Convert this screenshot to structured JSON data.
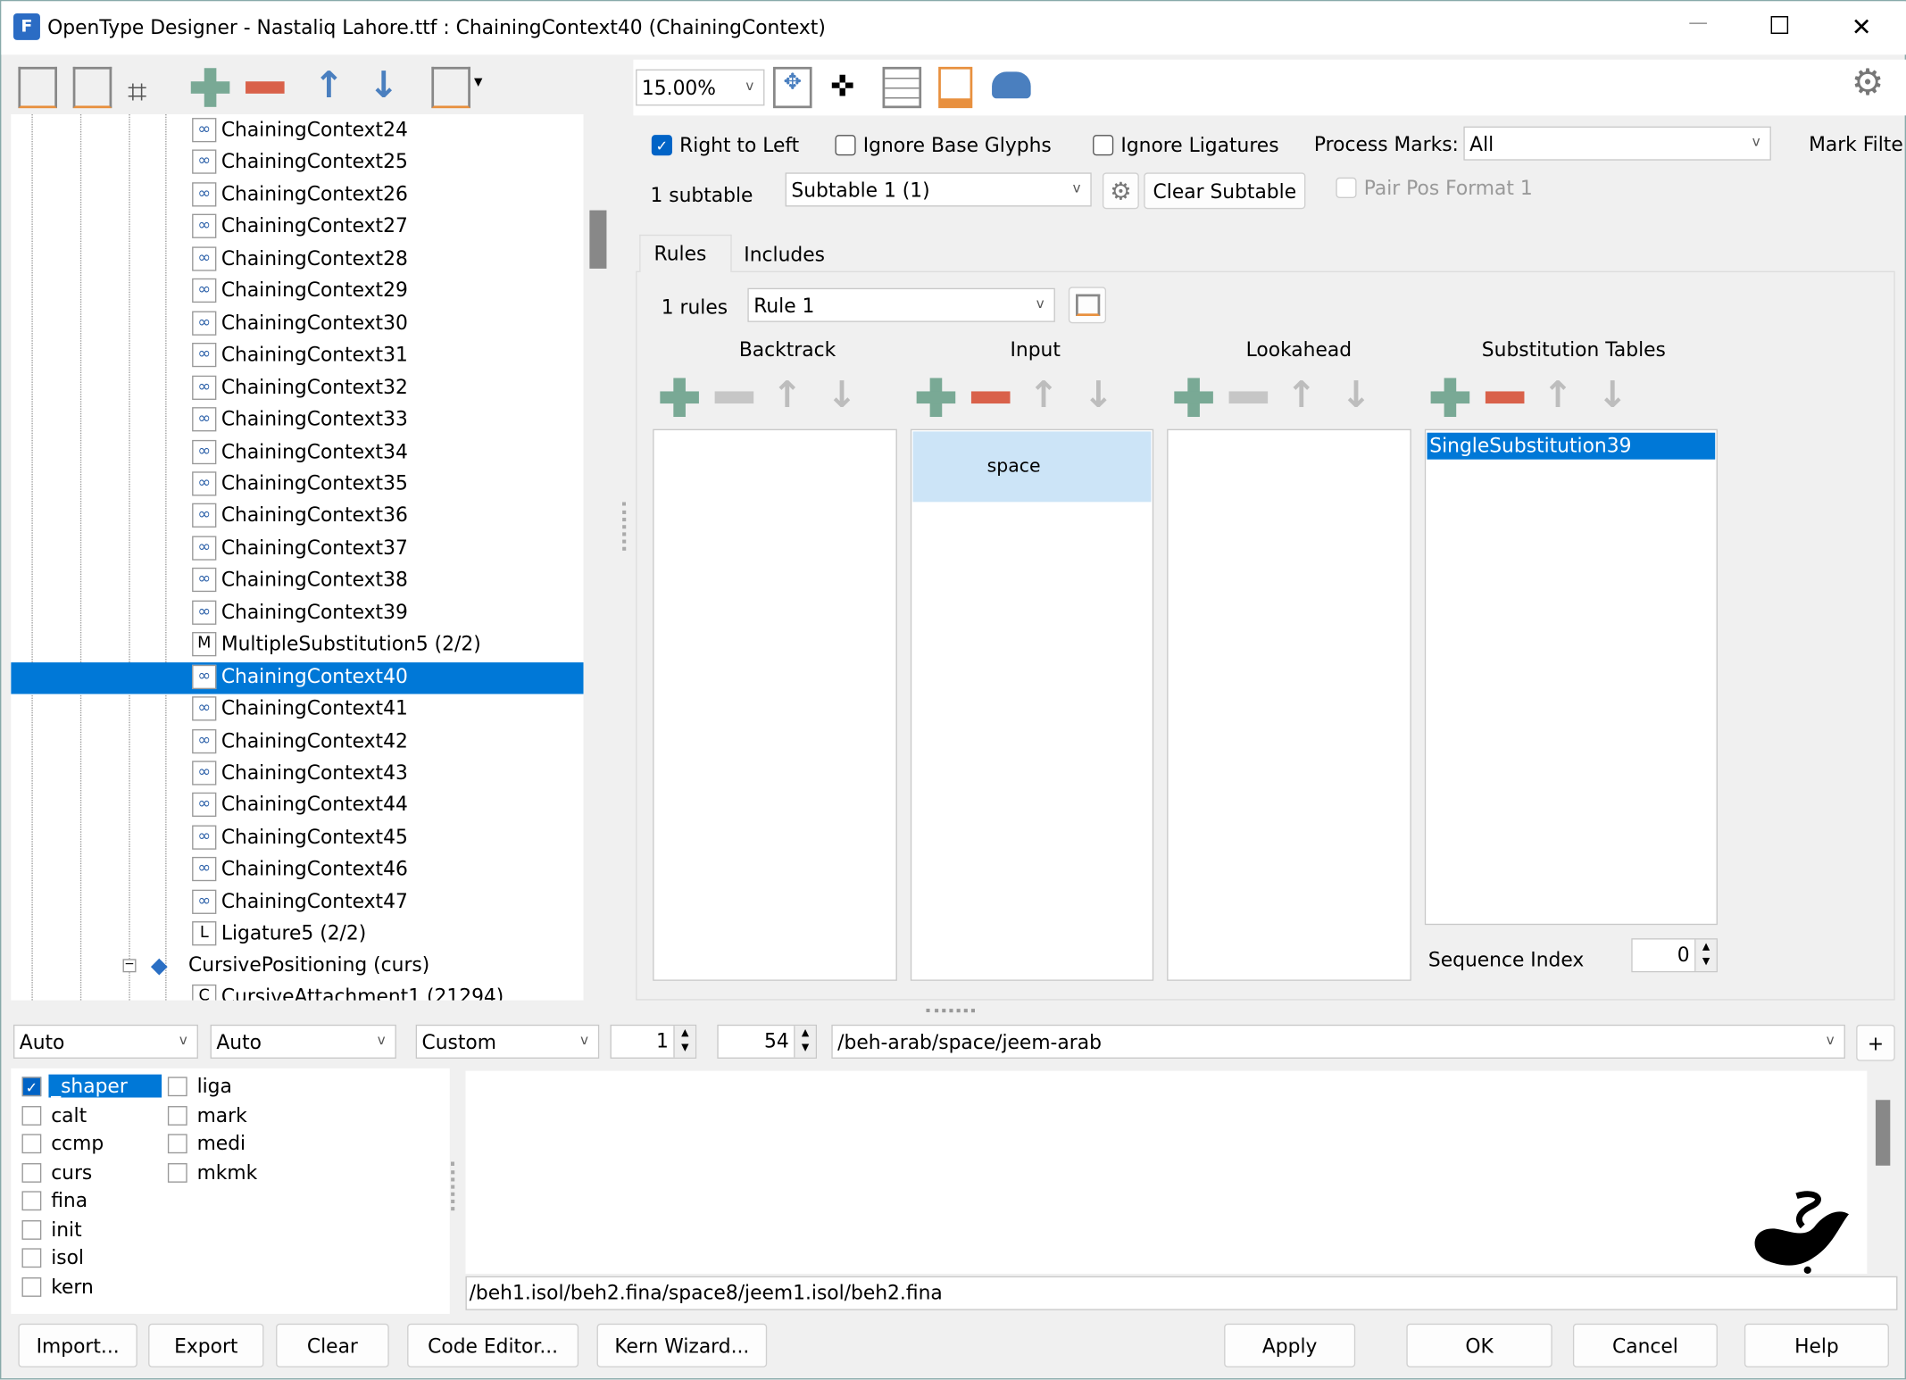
{
  "window": {
    "title": "OpenType Designer - Nastaliq Lahore.ttf : ChainingContext40 (ChainingContext)",
    "minimize": "—",
    "maximize": "☐",
    "close": "✕"
  },
  "toolbar_left": {
    "icons": [
      "lookup-preview-icon",
      "lookup-search-icon",
      "binoculars-icon",
      "add-icon",
      "remove-icon",
      "move-up-icon",
      "move-down-icon",
      "lookup-menu-icon"
    ]
  },
  "toolbar_right": {
    "zoom": "15.00%",
    "icons": [
      "fit-view-icon",
      "crosshair-icon",
      "glyph-grid-icon",
      "edit-pen-icon",
      "cloud-icon",
      "settings-gear-icon"
    ]
  },
  "tree": {
    "items": [
      {
        "label": "ChainingContext24",
        "icon": "chain"
      },
      {
        "label": "ChainingContext25",
        "icon": "chain"
      },
      {
        "label": "ChainingContext26",
        "icon": "chain"
      },
      {
        "label": "ChainingContext27",
        "icon": "chain"
      },
      {
        "label": "ChainingContext28",
        "icon": "chain"
      },
      {
        "label": "ChainingContext29",
        "icon": "chain"
      },
      {
        "label": "ChainingContext30",
        "icon": "chain"
      },
      {
        "label": "ChainingContext31",
        "icon": "chain"
      },
      {
        "label": "ChainingContext32",
        "icon": "chain"
      },
      {
        "label": "ChainingContext33",
        "icon": "chain"
      },
      {
        "label": "ChainingContext34",
        "icon": "chain"
      },
      {
        "label": "ChainingContext35",
        "icon": "chain"
      },
      {
        "label": "ChainingContext36",
        "icon": "chain"
      },
      {
        "label": "ChainingContext37",
        "icon": "chain"
      },
      {
        "label": "ChainingContext38",
        "icon": "chain"
      },
      {
        "label": "ChainingContext39",
        "icon": "chain"
      },
      {
        "label": "MultipleSubstitution5 (2/2)",
        "icon": "M"
      },
      {
        "label": "ChainingContext40",
        "icon": "chain",
        "selected": true
      },
      {
        "label": "ChainingContext41",
        "icon": "chain"
      },
      {
        "label": "ChainingContext42",
        "icon": "chain"
      },
      {
        "label": "ChainingContext43",
        "icon": "chain"
      },
      {
        "label": "ChainingContext44",
        "icon": "chain"
      },
      {
        "label": "ChainingContext45",
        "icon": "chain"
      },
      {
        "label": "ChainingContext46",
        "icon": "chain"
      },
      {
        "label": "ChainingContext47",
        "icon": "chain"
      },
      {
        "label": "Ligature5 (2/2)",
        "icon": "L"
      }
    ],
    "feature_node": "CursivePositioning (curs)",
    "partial_item": "CursiveAttachment1 (21294)"
  },
  "options": {
    "right_to_left": {
      "label": "Right to Left",
      "checked": true
    },
    "ignore_base": {
      "label": "Ignore Base Glyphs",
      "checked": false
    },
    "ignore_ligatures": {
      "label": "Ignore Ligatures",
      "checked": false
    },
    "process_marks_label": "Process Marks:",
    "process_marks_value": "All",
    "mark_filter_label": "Mark Filte"
  },
  "subtable": {
    "count_label": "1 subtable",
    "value": "Subtable 1 (1)",
    "clear_label": "Clear Subtable",
    "pair_pos_label": "Pair Pos Format 1"
  },
  "tabs": [
    {
      "label": "Rules",
      "active": true
    },
    {
      "label": "Includes"
    }
  ],
  "rules": {
    "count_label": "1 rules",
    "value": "Rule 1"
  },
  "columns": {
    "backtrack": "Backtrack",
    "input": "Input",
    "lookahead": "Lookahead",
    "substitution": "Substitution Tables"
  },
  "input_items": [
    "space"
  ],
  "substitution_items": [
    "SingleSubstitution39"
  ],
  "sequence_index": {
    "label": "Sequence Index",
    "value": "0"
  },
  "preview_controls": {
    "script": "Auto",
    "language": "Auto",
    "mode": "Custom",
    "spin1": "1",
    "spin2": "54",
    "text": "/beh-arab/space/jeem-arab",
    "add": "+"
  },
  "features": {
    "col1": [
      {
        "label": "_shaper",
        "checked": true
      },
      {
        "label": "calt"
      },
      {
        "label": "ccmp"
      },
      {
        "label": "curs"
      },
      {
        "label": "fina"
      },
      {
        "label": "init"
      },
      {
        "label": "isol"
      },
      {
        "label": "kern"
      }
    ],
    "col2": [
      {
        "label": "liga"
      },
      {
        "label": "mark"
      },
      {
        "label": "medi"
      },
      {
        "label": "mkmk"
      }
    ]
  },
  "output": "/beh1.isol/beh2.fina/space8/jeem1.isol/beh2.fina",
  "buttons": {
    "import": "Import...",
    "export": "Export",
    "clear": "Clear",
    "code_editor": "Code Editor...",
    "kern_wizard": "Kern Wizard...",
    "apply": "Apply",
    "ok": "OK",
    "cancel": "Cancel",
    "help": "Help"
  },
  "colors": {
    "selection": "#0078d7",
    "input_highlight": "#cce4f7",
    "add": "#79a995",
    "remove": "#d9614a",
    "arrow": "#4a7fbf"
  }
}
